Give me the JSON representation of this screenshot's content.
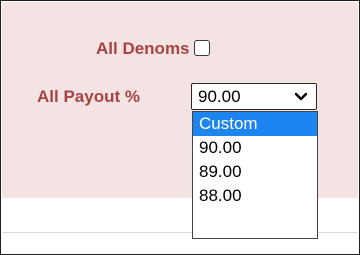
{
  "form": {
    "denoms_label": "All Denoms",
    "denoms_checked": false,
    "payout_label": "All Payout %",
    "payout_value": "90.00"
  },
  "dropdown": {
    "options": [
      "Custom",
      "90.00",
      "89.00",
      "88.00"
    ],
    "highlighted_option": "Custom"
  },
  "colors": {
    "panel_background": "#f3e3e3",
    "label_text": "#a84343",
    "selected_option": "#1e84f0"
  }
}
